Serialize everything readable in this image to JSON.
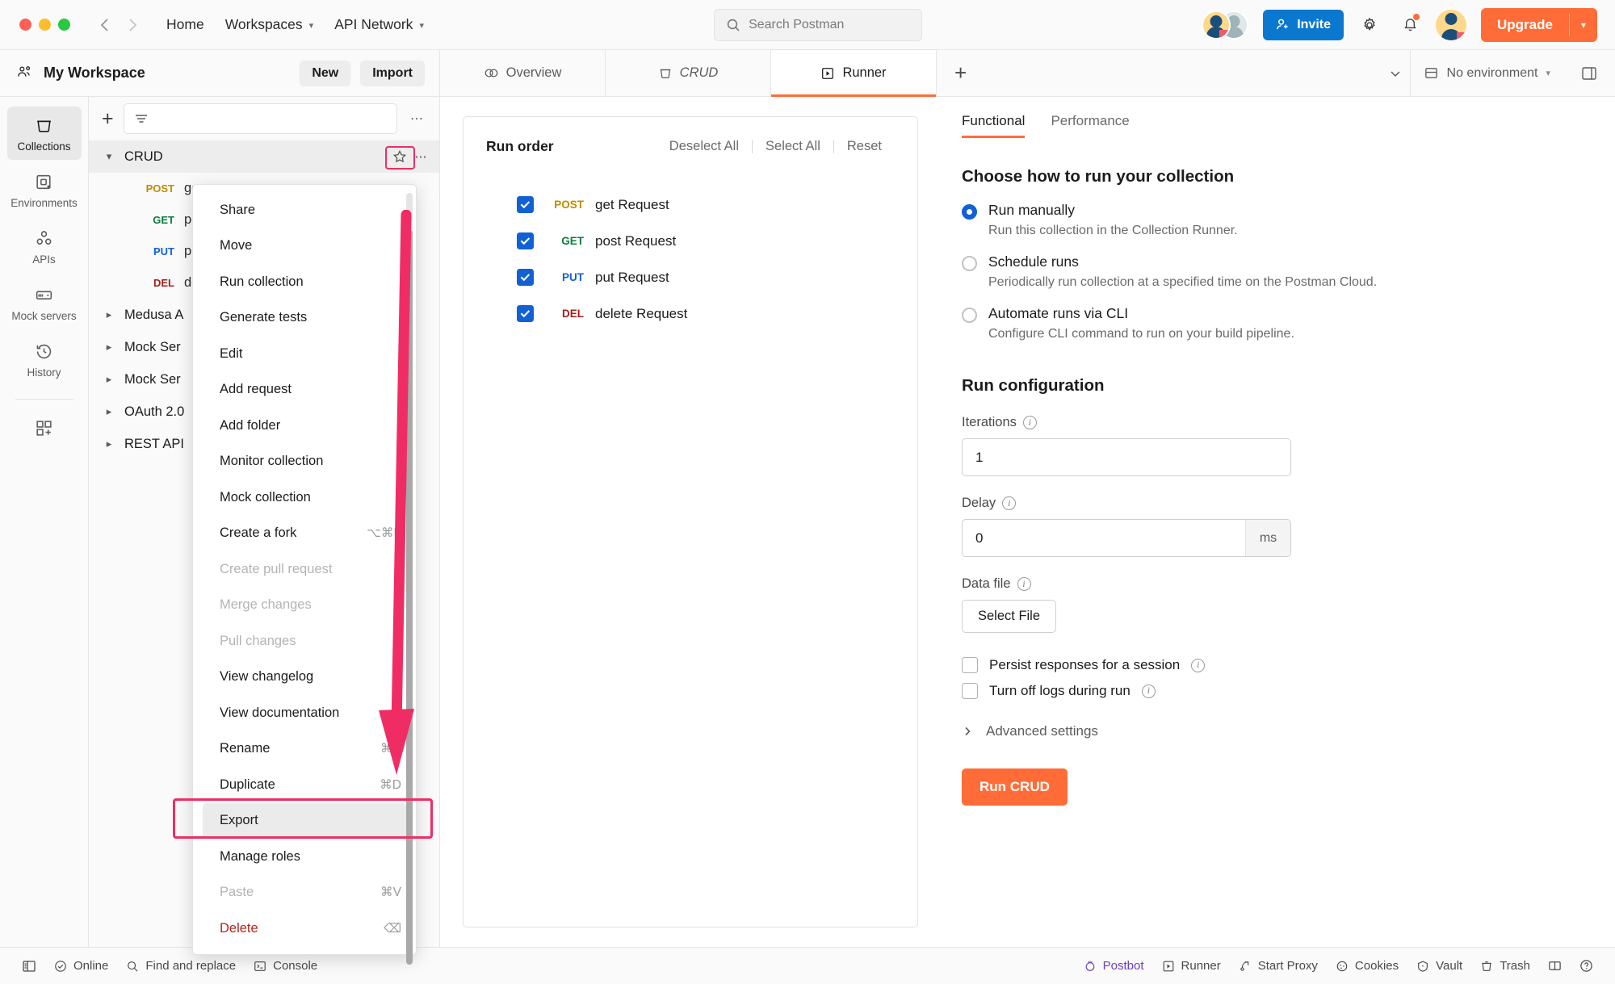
{
  "titlebar": {
    "back_icon": "arrow-left-icon",
    "forward_icon": "arrow-right-icon",
    "home_label": "Home",
    "workspaces_label": "Workspaces",
    "api_network_label": "API Network",
    "search_placeholder": "Search Postman",
    "invite_label": "Invite",
    "settings_icon": "gear-icon",
    "notifications_icon": "bell-icon",
    "upgrade_label": "Upgrade",
    "accent_color": "#ff6c37",
    "invite_color": "#0b78d0"
  },
  "workspace": {
    "name": "My Workspace",
    "new_label": "New",
    "import_label": "Import"
  },
  "tabs": [
    {
      "label": "Overview",
      "icon": "overview-icon",
      "active": false,
      "italic": false
    },
    {
      "label": "CRUD",
      "icon": "collection-icon",
      "active": false,
      "italic": true
    },
    {
      "label": "Runner",
      "icon": "runner-icon",
      "active": true,
      "italic": false
    }
  ],
  "tab_add_label": "+",
  "environment": {
    "label": "No environment",
    "icon": "environment-icon"
  },
  "rail": {
    "items": [
      {
        "label": "Collections",
        "icon": "collections-icon",
        "active": true
      },
      {
        "label": "Environments",
        "icon": "environments-icon",
        "active": false
      },
      {
        "label": "APIs",
        "icon": "apis-icon",
        "active": false
      },
      {
        "label": "Mock servers",
        "icon": "mock-servers-icon",
        "active": false
      },
      {
        "label": "History",
        "icon": "history-icon",
        "active": false
      }
    ],
    "add_label": "",
    "add_icon": "add-module-icon"
  },
  "sidebar": {
    "filter_placeholder": "",
    "filter_icon": "filter-icon",
    "add_icon": "plus-icon",
    "more_icon": "more-horizontal-icon",
    "collection": {
      "name": "CRUD",
      "expanded": true,
      "star_icon": "star-icon",
      "more_icon": "more-horizontal-icon"
    },
    "requests": [
      {
        "method": "POST",
        "name": "ge"
      },
      {
        "method": "GET",
        "name": "po"
      },
      {
        "method": "PUT",
        "name": "pu"
      },
      {
        "method": "DEL",
        "name": "de"
      }
    ],
    "other_collections": [
      {
        "name": "Medusa A"
      },
      {
        "name": "Mock Ser"
      },
      {
        "name": "Mock Ser"
      },
      {
        "name": "OAuth 2.0"
      },
      {
        "name": "REST API"
      }
    ]
  },
  "context_menu": {
    "items": [
      {
        "label": "Share",
        "shortcut": "",
        "state": "normal"
      },
      {
        "label": "Move",
        "shortcut": "",
        "state": "normal"
      },
      {
        "label": "Run collection",
        "shortcut": "",
        "state": "normal"
      },
      {
        "label": "Generate tests",
        "shortcut": "",
        "state": "normal"
      },
      {
        "label": "Edit",
        "shortcut": "",
        "state": "normal"
      },
      {
        "label": "Add request",
        "shortcut": "",
        "state": "normal"
      },
      {
        "label": "Add folder",
        "shortcut": "",
        "state": "normal"
      },
      {
        "label": "Monitor collection",
        "shortcut": "",
        "state": "normal"
      },
      {
        "label": "Mock collection",
        "shortcut": "",
        "state": "normal"
      },
      {
        "label": "Create a fork",
        "shortcut": "⌥⌘F",
        "state": "normal"
      },
      {
        "label": "Create pull request",
        "shortcut": "",
        "state": "disabled"
      },
      {
        "label": "Merge changes",
        "shortcut": "",
        "state": "disabled"
      },
      {
        "label": "Pull changes",
        "shortcut": "",
        "state": "disabled"
      },
      {
        "label": "View changelog",
        "shortcut": "",
        "state": "normal"
      },
      {
        "label": "View documentation",
        "shortcut": "",
        "state": "normal"
      },
      {
        "label": "Rename",
        "shortcut": "⌘E",
        "state": "normal"
      },
      {
        "label": "Duplicate",
        "shortcut": "⌘D",
        "state": "normal"
      },
      {
        "label": "Export",
        "shortcut": "",
        "state": "hover"
      },
      {
        "label": "Manage roles",
        "shortcut": "",
        "state": "normal"
      },
      {
        "label": "Paste",
        "shortcut": "⌘V",
        "state": "disabled"
      },
      {
        "label": "Delete",
        "shortcut": "⌫",
        "state": "danger"
      }
    ],
    "highlight_color": "#ef2d64"
  },
  "run_order": {
    "title": "Run order",
    "deselect_all": "Deselect All",
    "select_all": "Select All",
    "reset": "Reset",
    "items": [
      {
        "method": "POST",
        "name": "get Request",
        "checked": true
      },
      {
        "method": "GET",
        "name": "post Request",
        "checked": true
      },
      {
        "method": "PUT",
        "name": "put Request",
        "checked": true
      },
      {
        "method": "DEL",
        "name": "delete Request",
        "checked": true
      }
    ]
  },
  "runner": {
    "tabs": [
      {
        "label": "Functional",
        "active": true
      },
      {
        "label": "Performance",
        "active": false
      }
    ],
    "choose_title": "Choose how to run your collection",
    "run_modes": [
      {
        "label": "Run manually",
        "desc": "Run this collection in the Collection Runner.",
        "selected": true
      },
      {
        "label": "Schedule runs",
        "desc": "Periodically run collection at a specified time on the Postman Cloud.",
        "selected": false
      },
      {
        "label": "Automate runs via CLI",
        "desc": "Configure CLI command to run on your build pipeline.",
        "selected": false
      }
    ],
    "config_title": "Run configuration",
    "iterations_label": "Iterations",
    "iterations_value": "1",
    "delay_label": "Delay",
    "delay_value": "0",
    "delay_unit": "ms",
    "data_file_label": "Data file",
    "select_file_label": "Select File",
    "checkboxes": [
      {
        "label": "Persist responses for a session",
        "checked": false
      },
      {
        "label": "Turn off logs during run",
        "checked": false
      }
    ],
    "advanced_label": "Advanced settings",
    "run_button_label": "Run CRUD"
  },
  "statusbar": {
    "left": [
      {
        "label": "",
        "icon": "sidebar-toggle-icon"
      },
      {
        "label": "Online",
        "icon": "check-circle-icon"
      },
      {
        "label": "Find and replace",
        "icon": "search-icon"
      },
      {
        "label": "Console",
        "icon": "console-icon"
      }
    ],
    "right": [
      {
        "label": "Postbot",
        "icon": "postbot-icon",
        "accent": true
      },
      {
        "label": "Runner",
        "icon": "runner-icon",
        "accent": false
      },
      {
        "label": "Start Proxy",
        "icon": "proxy-icon",
        "accent": false
      },
      {
        "label": "Cookies",
        "icon": "cookie-icon",
        "accent": false
      },
      {
        "label": "Vault",
        "icon": "vault-icon",
        "accent": false
      },
      {
        "label": "Trash",
        "icon": "trash-icon",
        "accent": false
      },
      {
        "label": "",
        "icon": "layout-icon",
        "accent": false
      },
      {
        "label": "",
        "icon": "help-icon",
        "accent": false
      }
    ]
  }
}
